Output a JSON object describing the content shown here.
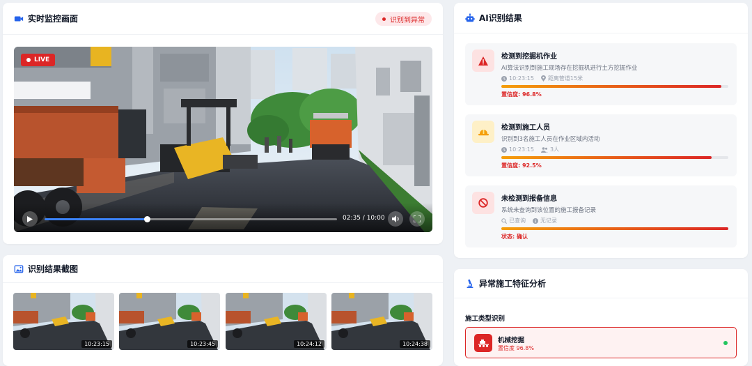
{
  "monitor": {
    "title": "实时监控画面",
    "alert_badge": "识别到异常",
    "live_label": "LIVE",
    "time": "02:35 / 10:00",
    "progress": 0.35
  },
  "screenshots": {
    "title": "识别结果截图",
    "items": [
      {
        "time": "10:23:15"
      },
      {
        "time": "10:23:45"
      },
      {
        "time": "10:24:12"
      },
      {
        "time": "10:24:38"
      }
    ]
  },
  "ai": {
    "title": "AI识别结果",
    "results": [
      {
        "title": "检测到挖掘机作业",
        "desc": "AI算法识别到施工现场存在挖掘机进行土方挖掘作业",
        "meta1": "10:23:15",
        "meta2": "距离管道15米",
        "bar": 0.968,
        "conf": "置信度: 96.8%",
        "icon": "warning-icon",
        "color": "#dc2626"
      },
      {
        "title": "检测到施工人员",
        "desc": "识别到3名施工人员在作业区域内活动",
        "meta1": "10:23:15",
        "meta2": "3人",
        "bar": 0.925,
        "conf": "置信度: 92.5%",
        "icon": "helmet-icon",
        "color": "#f59e0b"
      },
      {
        "title": "未检测到报备信息",
        "desc": "系统未查询到该位置的施工报备记录",
        "meta1": "已查询",
        "meta2": "无记录",
        "bar": 1.0,
        "conf": "状态: 确认",
        "icon": "ban-icon",
        "color": "#dc2626"
      }
    ]
  },
  "analysis": {
    "title": "异常施工特征分析",
    "subtitle": "施工类型识别",
    "type_name": "机械挖掘",
    "type_conf": "置信度 96.8%"
  },
  "colors": {
    "accent": "#2563eb",
    "danger": "#dc2626",
    "warn": "#f59e0b",
    "ok": "#22c55e"
  }
}
